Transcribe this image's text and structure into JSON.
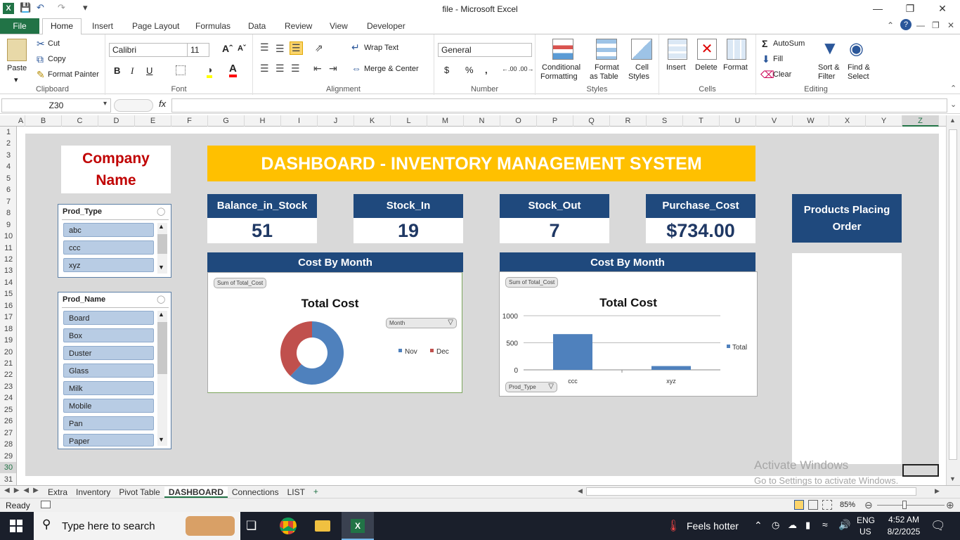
{
  "window": {
    "title": "file  -  Microsoft Excel"
  },
  "tabs": {
    "file": "File",
    "home": "Home",
    "insert": "Insert",
    "page_layout": "Page Layout",
    "formulas": "Formulas",
    "data": "Data",
    "review": "Review",
    "view": "View",
    "developer": "Developer"
  },
  "ribbon": {
    "clipboard": {
      "label": "Clipboard",
      "paste": "Paste",
      "cut": "Cut",
      "copy": "Copy",
      "format_painter": "Format Painter"
    },
    "font": {
      "label": "Font",
      "name": "Calibri",
      "size": "11",
      "bold": "B",
      "italic": "I",
      "underline": "U"
    },
    "alignment": {
      "label": "Alignment",
      "wrap_text": "Wrap Text",
      "merge_center": "Merge & Center"
    },
    "number": {
      "label": "Number",
      "format": "General",
      "currency": "$",
      "percent": "%",
      "comma": ","
    },
    "styles": {
      "label": "Styles",
      "conditional": "Conditional",
      "formatting": "Formatting",
      "format_as": "Format",
      "as_table": "as Table",
      "cell": "Cell",
      "cell_styles": "Styles"
    },
    "cells": {
      "label": "Cells",
      "insert": "Insert",
      "delete": "Delete",
      "format": "Format"
    },
    "editing": {
      "label": "Editing",
      "autosum": "AutoSum",
      "fill": "Fill",
      "clear": "Clear",
      "sort": "Sort &",
      "filter": "Filter",
      "find": "Find &",
      "select": "Select"
    }
  },
  "formula_bar": {
    "name_box": "Z30",
    "fx": "fx",
    "value": ""
  },
  "columns": [
    "A",
    "B",
    "C",
    "D",
    "E",
    "F",
    "G",
    "H",
    "I",
    "J",
    "K",
    "L",
    "M",
    "N",
    "O",
    "P",
    "Q",
    "R",
    "S",
    "T",
    "U",
    "V",
    "W",
    "X",
    "Y",
    "Z"
  ],
  "rows": [
    "1",
    "2",
    "3",
    "4",
    "5",
    "6",
    "7",
    "8",
    "9",
    "10",
    "11",
    "12",
    "13",
    "14",
    "15",
    "16",
    "17",
    "18",
    "19",
    "20",
    "21",
    "22",
    "23",
    "24",
    "25",
    "26",
    "27",
    "28",
    "29",
    "30",
    "31"
  ],
  "dashboard": {
    "company_line1": "Company",
    "company_line2": "Name",
    "banner": "DASHBOARD - INVENTORY MANAGEMENT SYSTEM",
    "kpis": [
      {
        "label": "Balance_in_Stock",
        "value": "51"
      },
      {
        "label": "Stock_In",
        "value": "19"
      },
      {
        "label": "Stock_Out",
        "value": "7"
      },
      {
        "label": "Purchase_Cost",
        "value": "$734.00"
      }
    ],
    "ppo_line1": "Products Placing",
    "ppo_line2": "Order"
  },
  "slicers": {
    "prod_type": {
      "title": "Prod_Type",
      "items": [
        "abc",
        "ccc",
        "xyz"
      ]
    },
    "prod_name": {
      "title": "Prod_Name",
      "items": [
        "Board",
        "Box",
        "Duster",
        "Glass",
        "Milk",
        "Mobile",
        "Pan",
        "Paper"
      ]
    }
  },
  "chart_data": [
    {
      "type": "pie",
      "header": "Cost By Month",
      "title": "Total Cost",
      "field_button": "Sum of Total_Cost",
      "filter_button": "Month",
      "categories": [
        "Nov",
        "Dec"
      ],
      "values": [
        62,
        38
      ],
      "colors": [
        "#4f81bd",
        "#c0504d"
      ],
      "donut": true,
      "legend": "right"
    },
    {
      "type": "bar",
      "header": "Cost By Month",
      "title": "Total Cost",
      "field_button": "Sum of Total_Cost",
      "filter_button": "Prod_Type",
      "categories": [
        "ccc",
        "xyz"
      ],
      "series": [
        {
          "name": "Total",
          "values": [
            660,
            70
          ]
        }
      ],
      "ylim": [
        0,
        1000
      ],
      "yticks": [
        "0",
        "500",
        "1000"
      ],
      "color": "#4f81bd",
      "legend": "right",
      "grid": true
    }
  ],
  "sheet_tabs": [
    "Extra",
    "Inventory",
    "Pivot Table",
    "DASHBOARD",
    "Connections",
    "LIST"
  ],
  "active_sheet": "DASHBOARD",
  "status": {
    "ready": "Ready",
    "zoom": "85%"
  },
  "watermark": {
    "line1": "Activate Windows",
    "line2": "Go to Settings to activate Windows."
  },
  "taskbar": {
    "search": "Type here to search",
    "weather": "Feels hotter",
    "lang1": "ENG",
    "lang2": "US",
    "time": "4:52 AM",
    "date": "8/2/2025"
  }
}
